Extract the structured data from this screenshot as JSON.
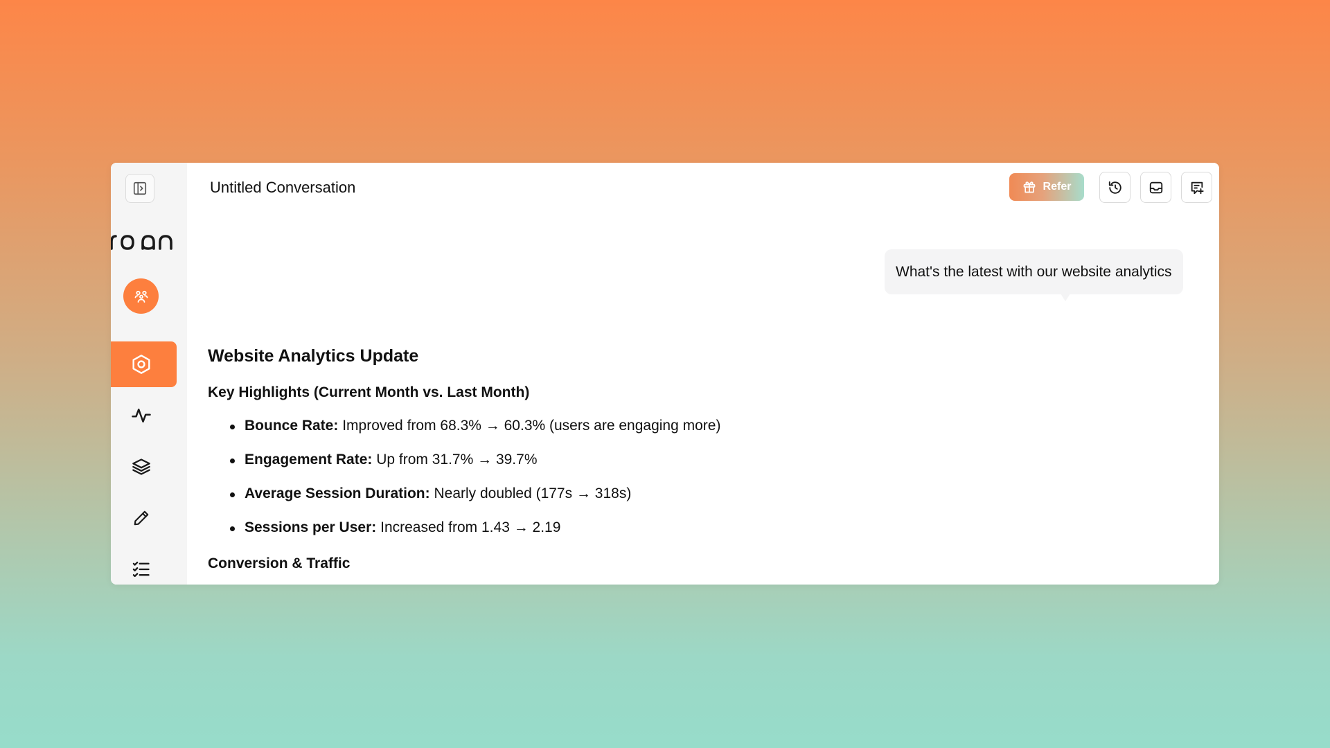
{
  "header": {
    "title": "Untitled Conversation",
    "refer_label": "Refer"
  },
  "sidebar": {
    "logo_text": "noan",
    "items": [
      {
        "name": "hexagon",
        "active": true
      },
      {
        "name": "activity",
        "active": false
      },
      {
        "name": "layers",
        "active": false
      },
      {
        "name": "pencil",
        "active": false
      },
      {
        "name": "checklist",
        "active": false
      }
    ]
  },
  "user_message": "What's the latest with our website analytics",
  "response": {
    "heading": "Website Analytics Update",
    "subheading": "Key Highlights (Current Month vs. Last Month)",
    "bullets": [
      {
        "label": "Bounce Rate:",
        "text": "Improved from 68.3% → 60.3% (users are engaging more)"
      },
      {
        "label": "Engagement Rate:",
        "text": "Up from 31.7% → 39.7%"
      },
      {
        "label": "Average Session Duration:",
        "text": "Nearly doubled (177s → 318s)"
      },
      {
        "label": "Sessions per User:",
        "text": "Increased from 1.43 → 2.19"
      }
    ],
    "section2_heading": "Conversion & Traffic"
  },
  "colors": {
    "accent": "#fd7f3e",
    "sidebar_bg": "#f5f5f5",
    "bubble_bg": "#f4f4f5"
  }
}
